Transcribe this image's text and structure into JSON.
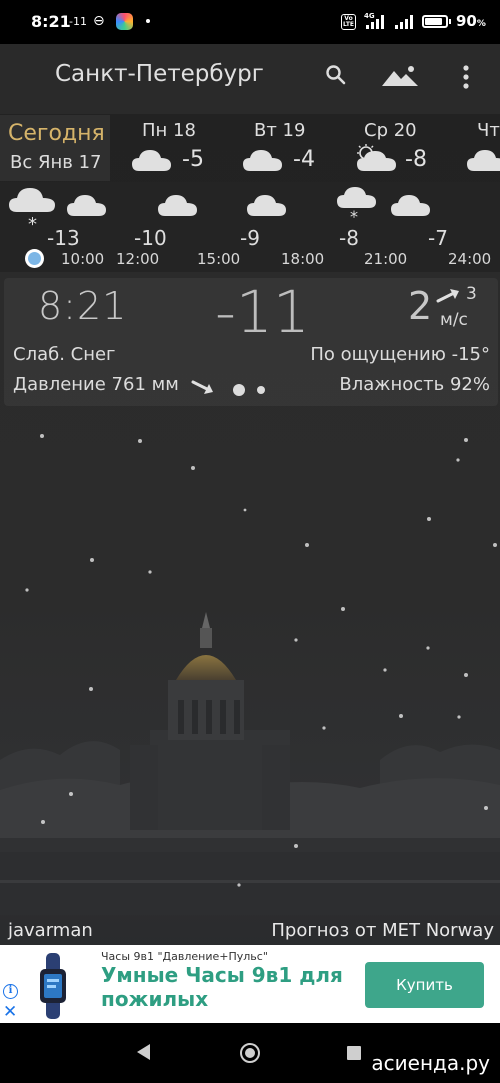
{
  "status_bar": {
    "time": "8:21",
    "temp": "-11",
    "network": "4G",
    "volte": "Vo LTE",
    "battery_pct": "90",
    "battery_unit": "%"
  },
  "header": {
    "city": "Санкт-Петербург",
    "icons": [
      "search-icon",
      "landscape-icon",
      "more-vert-icon"
    ]
  },
  "forecast": {
    "today_label": "Сегодня",
    "today_date": "Вс Янв 17",
    "days": [
      {
        "name": "Пн 18",
        "temp": "-5",
        "icon": "cloud-icon"
      },
      {
        "name": "Вт 19",
        "temp": "-4",
        "icon": "cloud-icon"
      },
      {
        "name": "Ср 20",
        "temp": "-8",
        "icon": "partly-cloudy-icon"
      },
      {
        "name": "Чт",
        "temp": "",
        "icon": "cloud-icon"
      }
    ]
  },
  "hourly": {
    "temps": [
      "-13",
      "-10",
      "-9",
      "-8",
      "-7"
    ],
    "times": [
      "10:00",
      "12:00",
      "15:00",
      "18:00",
      "21:00",
      "24:00"
    ]
  },
  "current": {
    "time": "8:21",
    "temp": "-11",
    "wind_speed": "2",
    "wind_gust": "3",
    "wind_unit": "м/с",
    "condition": "Слаб. Снег",
    "feels_like": "По ощущению -15°",
    "pressure": "Давление 761 мм",
    "humidity": "Влажность 92%"
  },
  "footer": {
    "author": "javarman",
    "source": "Прогноз от MET Norway"
  },
  "ad": {
    "subtitle": "Часы 9в1 \"Давление+Пульс\"",
    "title": "Умные Часы 9в1 для пожилых",
    "button": "Купить"
  },
  "watermark": "асиенда.ру",
  "colors": {
    "today_accent": "#d6b46a",
    "ad_green": "#3ea68b",
    "now_dot": "#7cb6e6"
  }
}
